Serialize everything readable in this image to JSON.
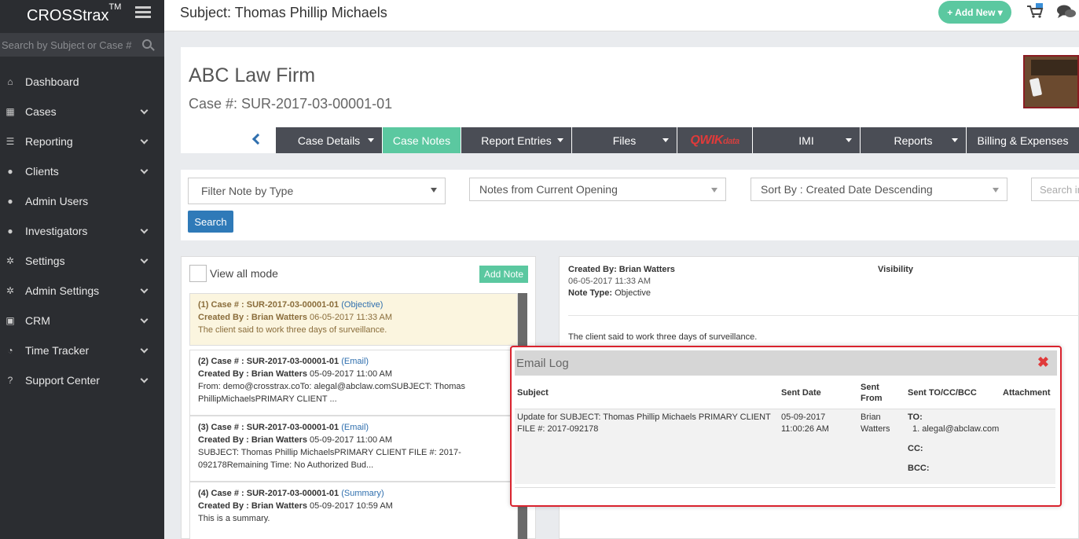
{
  "brand": {
    "name": "CROSStrax",
    "tm": "TM"
  },
  "sidebar": {
    "search_placeholder": "Search by Subject or Case #",
    "items": [
      {
        "label": "Dashboard",
        "icon": "home-icon",
        "has_children": false
      },
      {
        "label": "Cases",
        "icon": "grid-icon",
        "has_children": true
      },
      {
        "label": "Reporting",
        "icon": "list-icon",
        "has_children": true
      },
      {
        "label": "Clients",
        "icon": "user-icon",
        "has_children": true
      },
      {
        "label": "Admin Users",
        "icon": "user-icon",
        "has_children": false
      },
      {
        "label": "Investigators",
        "icon": "users-icon",
        "has_children": true
      },
      {
        "label": "Settings",
        "icon": "gear-icon",
        "has_children": true
      },
      {
        "label": "Admin Settings",
        "icon": "gears-icon",
        "has_children": true
      },
      {
        "label": "CRM",
        "icon": "cubes-icon",
        "has_children": true
      },
      {
        "label": "Time Tracker",
        "icon": "clock-icon",
        "has_children": true
      },
      {
        "label": "Support Center",
        "icon": "question-icon",
        "has_children": true
      }
    ]
  },
  "header": {
    "title": "Subject: Thomas Phillip Michaels",
    "add_new_label": "+ Add New ▾"
  },
  "case": {
    "firm_name": "ABC Law Firm",
    "case_number": "Case #: SUR-2017-03-00001-01"
  },
  "tabs": [
    {
      "label": "Case Details",
      "active": false,
      "caret": true
    },
    {
      "label": "Case Notes",
      "active": true,
      "caret": false
    },
    {
      "label": "Report Entries",
      "active": false,
      "caret": true
    },
    {
      "label": "Files",
      "active": false,
      "caret": true
    },
    {
      "label": "QWIK",
      "sub": "data",
      "active": false,
      "caret": false
    },
    {
      "label": "IMI",
      "active": false,
      "caret": true
    },
    {
      "label": "Reports",
      "active": false,
      "caret": true
    },
    {
      "label": "Billing & Expenses",
      "active": false,
      "caret": false
    }
  ],
  "filters": {
    "note_type": "Filter Note by Type",
    "opening": "Notes from Current Opening",
    "sort": "Sort By : Created Date Descending",
    "search_placeholder": "Search in",
    "search_button": "Search"
  },
  "notes_panel": {
    "view_all_label": "View all mode",
    "add_note_label": "Add Note",
    "notes": [
      {
        "case": "(1) Case # : SUR-2017-03-00001-01",
        "type": "(Objective)",
        "created": "Created By : Brian Watters",
        "date": "06-05-2017 11:33 AM",
        "body": "The client said to work three days of surveillance."
      },
      {
        "case": "(2) Case # : SUR-2017-03-00001-01",
        "type": "(Email)",
        "created": "Created By : Brian Watters",
        "date": "05-09-2017 11:00 AM",
        "body": "From: demo@crosstrax.coTo: alegal@abclaw.comSUBJECT: Thomas PhillipMichaelsPRIMARY CLIENT ..."
      },
      {
        "case": "(3) Case # : SUR-2017-03-00001-01",
        "type": "(Email)",
        "created": "Created By : Brian Watters",
        "date": "05-09-2017 11:00 AM",
        "body": "SUBJECT: Thomas Phillip MichaelsPRIMARY CLIENT FILE #: 2017-092178Remaining Time: No Authorized Bud..."
      },
      {
        "case": "(4) Case # : SUR-2017-03-00001-01",
        "type": "(Summary)",
        "created": "Created By : Brian Watters",
        "date": "05-09-2017 10:59 AM",
        "body": "This is a summary."
      }
    ]
  },
  "detail": {
    "created_by": "Created By: Brian Watters",
    "date": "06-05-2017 11:33 AM",
    "note_type_label": "Note Type:",
    "note_type_value": "Objective",
    "visibility_label": "Visibility",
    "body": "The client said to work three days of surveillance."
  },
  "email_log": {
    "title": "Email Log",
    "headers": {
      "subject": "Subject",
      "sent_date": "Sent Date",
      "sent_from": "Sent From",
      "sent_to": "Sent TO/CC/BCC",
      "attachment": "Attachment"
    },
    "row": {
      "subject": "Update for SUBJECT: Thomas Phillip Michaels PRIMARY CLIENT FILE #: 2017-092178",
      "date": "05-09-2017",
      "time": "11:00:26 AM",
      "from": "Brian Watters",
      "to_label": "TO:",
      "to_value": "1. alegal@abclaw.com",
      "cc_label": "CC:",
      "bcc_label": "BCC:"
    }
  },
  "colors": {
    "accent": "#5bc8a0",
    "tab_dark": "#4a4d55",
    "sidebar": "#2b2d31",
    "alert": "#d9232e"
  }
}
